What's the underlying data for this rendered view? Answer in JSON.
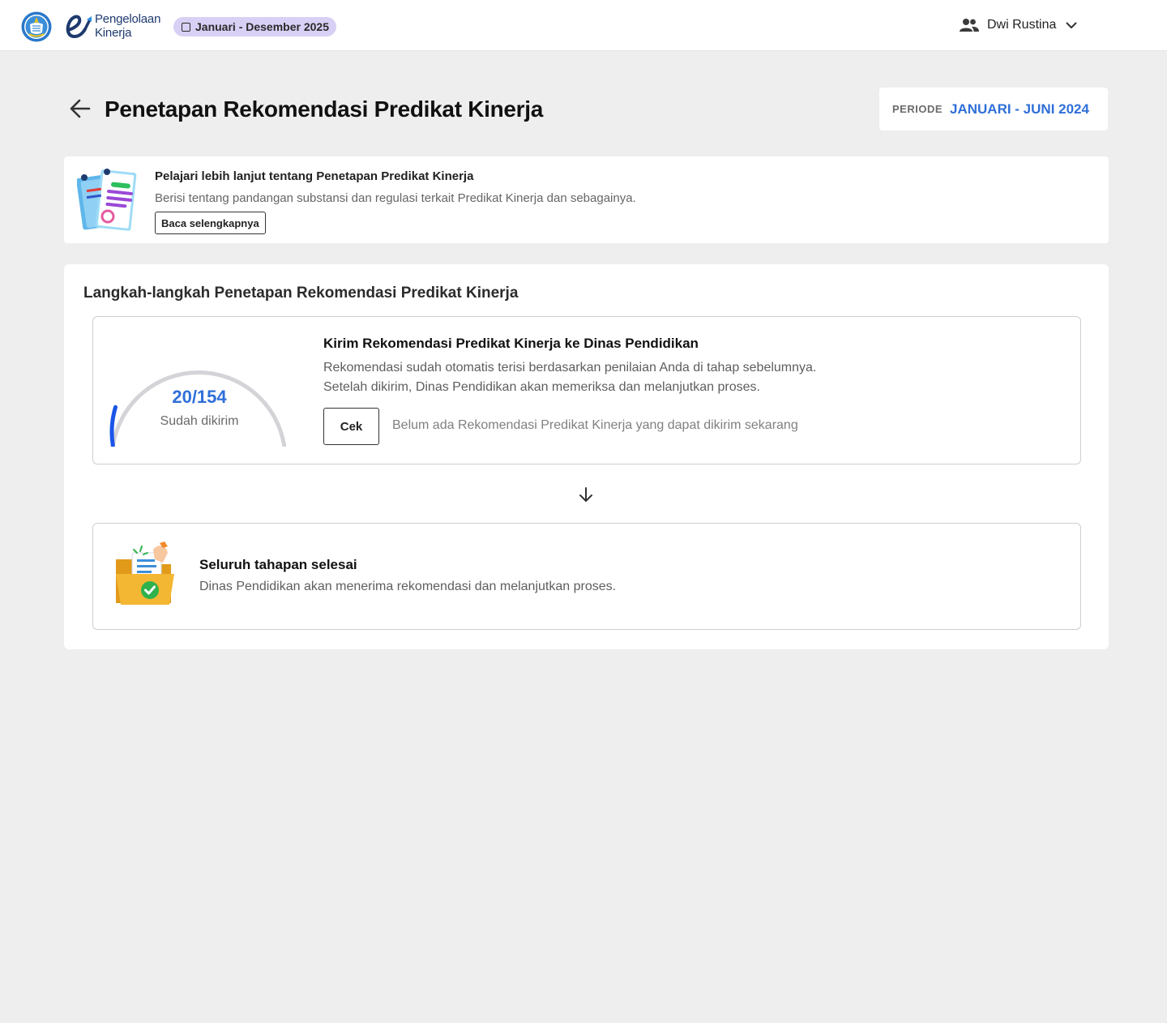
{
  "header": {
    "brand_line1": "Pengelolaan",
    "brand_line2": "Kinerja",
    "period_badge": "Januari - Desember 2025",
    "user_name": "Dwi Rustina",
    "icons": [
      "kemdikbud-logo",
      "e-kinerja-logo",
      "calendar-icon",
      "users-icon",
      "chevron-down-icon"
    ]
  },
  "page": {
    "title": "Penetapan Rekomendasi Predikat Kinerja",
    "periode_label": "PERIODE",
    "periode_value": "JANUARI - JUNI 2024"
  },
  "info": {
    "title": "Pelajari lebih lanjut tentang Penetapan Predikat Kinerja",
    "description": "Berisi tentang pandangan substansi dan regulasi terkait Predikat Kinerja dan sebagainya.",
    "button": "Baca selengkapnya"
  },
  "steps": {
    "title": "Langkah-langkah Penetapan Rekomendasi Predikat Kinerja",
    "step1": {
      "sent": 20,
      "total": 154,
      "count_text": "20/154",
      "count_label": "Sudah dikirim",
      "title": "Kirim Rekomendasi Predikat Kinerja ke Dinas Pendidikan",
      "desc_line1": "Rekomendasi sudah otomatis terisi berdasarkan penilaian Anda di tahap sebelumnya.",
      "desc_line2": "Setelah dikirim, Dinas Pendidikan akan memeriksa dan melanjutkan proses.",
      "button": "Cek",
      "note": "Belum ada Rekomendasi Predikat Kinerja yang dapat dikirim sekarang"
    },
    "step2": {
      "title": "Seluruh tahapan selesai",
      "description": "Dinas Pendidikan akan menerima rekomendasi dan melanjutkan proses."
    }
  },
  "colors": {
    "accent": "#2f6fd8",
    "gauge_fill": "#1a55e8",
    "gauge_track": "#d4d4d8",
    "badge_bg": "#d9d0f5",
    "page_bg": "#eeeeee"
  }
}
